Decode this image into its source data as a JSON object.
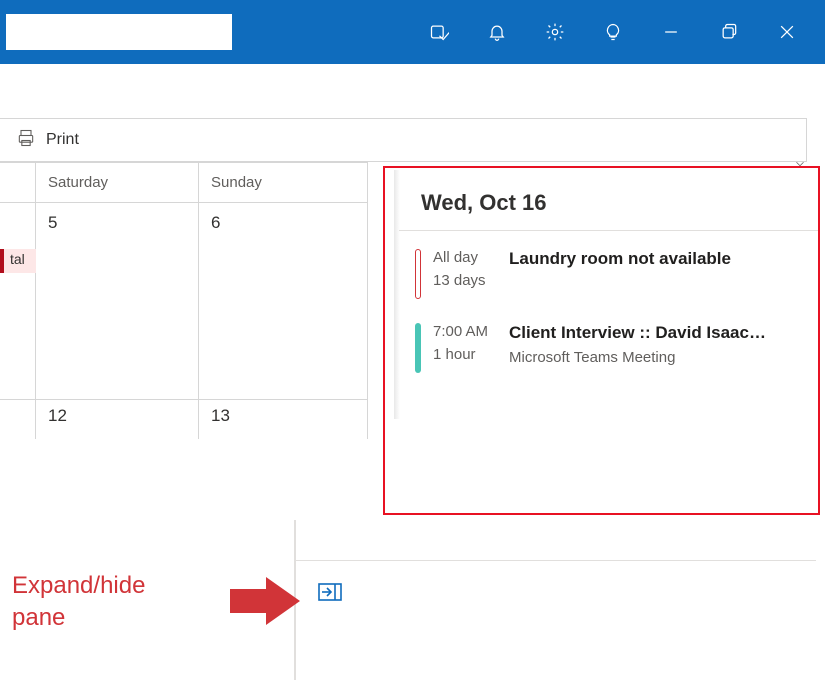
{
  "toolbar": {
    "print_label": "Print"
  },
  "calendar": {
    "headers": {
      "sat": "Saturday",
      "sun": "Sunday"
    },
    "row1": {
      "sat": "5",
      "sun": "6",
      "fri_event": "tal"
    },
    "row2": {
      "sat": "12",
      "sun": "13"
    }
  },
  "panel": {
    "date": "Wed, Oct 16",
    "events": [
      {
        "time": "All day",
        "duration": "13 days",
        "title": "Laundry room not available",
        "sub": "",
        "bar": "red-outline"
      },
      {
        "time": "7:00 AM",
        "duration": "1 hour",
        "title": "Client Interview :: David Isaac…",
        "sub": "Microsoft Teams Meeting",
        "bar": "teal"
      }
    ]
  },
  "annotation": {
    "line1": "Expand/hide",
    "line2": "pane"
  }
}
